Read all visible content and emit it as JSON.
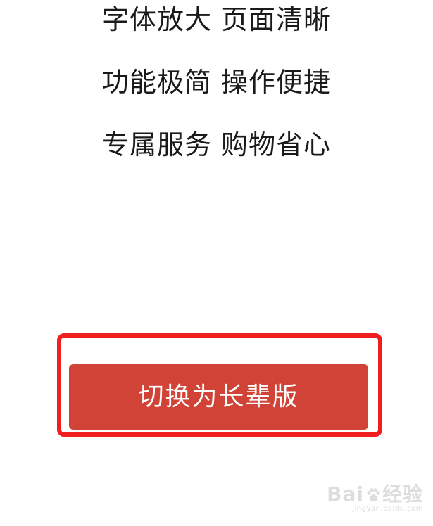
{
  "features": [
    "字体放大 页面清晰",
    "功能极简 操作便捷",
    "专属服务 购物省心"
  ],
  "switch_button": {
    "label": "切换为长辈版"
  },
  "colors": {
    "button_bg": "#d14336",
    "highlight_border": "#f01e1e"
  },
  "watermark": {
    "brand_left": "Bai",
    "brand_right": "经验",
    "site": "jingyan.baidu.com",
    "icon": "baidu-paw-icon"
  }
}
